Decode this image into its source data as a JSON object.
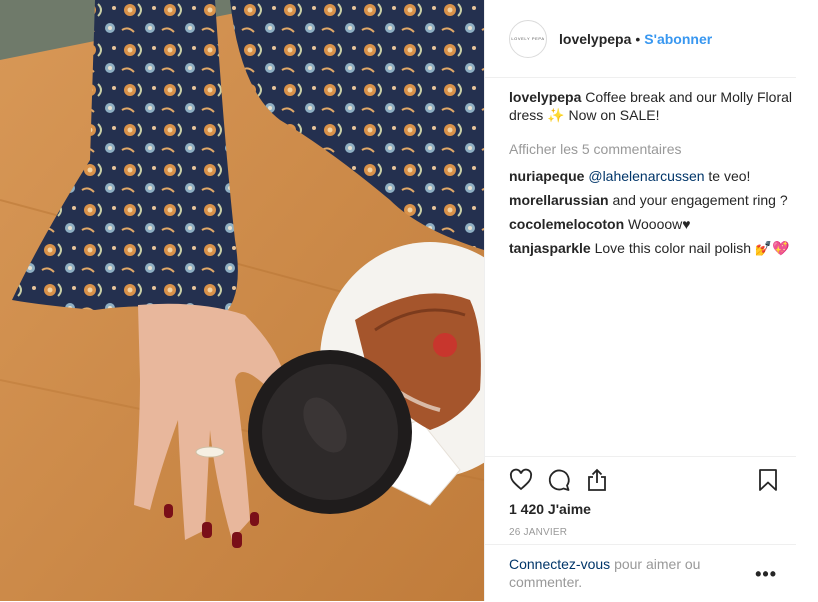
{
  "post": {
    "author": "lovelypepa",
    "avatar_text": "LOVELY PEPA",
    "follow_label": "S'abonner",
    "separator": "•",
    "caption": {
      "user": "lovelypepa",
      "text_1": "Coffee break and our Molly Floral dress",
      "emoji": "✨",
      "text_2": "Now on SALE!"
    },
    "view_all_label": "Afficher les 5 commentaires",
    "comments": [
      {
        "user": "nuriapeque",
        "mention": "@lahelenarcussen",
        "text": "te veo!"
      },
      {
        "user": "morellarussian",
        "text": "and your engagement ring ?"
      },
      {
        "user": "cocolemelocoton",
        "text": "Woooow♥"
      },
      {
        "user": "tanjasparkle",
        "text": "Love this color nail polish",
        "emoji": "💅💖"
      }
    ],
    "likes": "1 420 J'aime",
    "date": "26 JANVIER",
    "login": {
      "link": "Connectez-vous",
      "text": "pour aimer ou commenter."
    },
    "more_label": "•••"
  },
  "icons": {
    "like": "heart-icon",
    "comment": "comment-icon",
    "share": "share-icon",
    "save": "bookmark-icon",
    "more": "more-icon"
  },
  "colors": {
    "follow": "#3897f0",
    "mention": "#003569",
    "muted": "#999999",
    "text": "#262626",
    "border": "#efefef"
  }
}
